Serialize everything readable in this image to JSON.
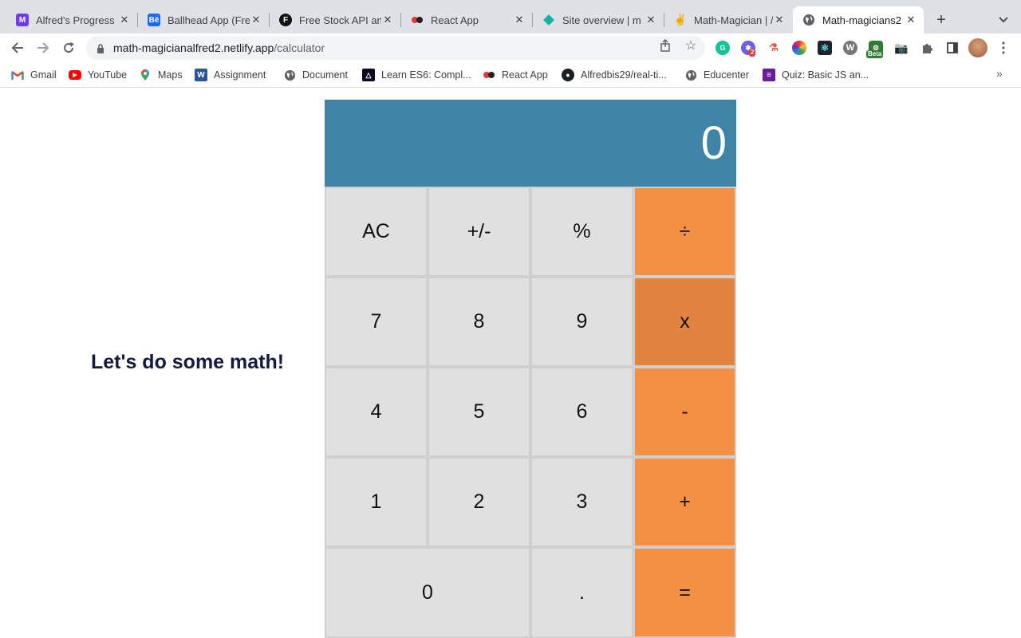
{
  "browser": {
    "tabs": [
      {
        "title": "Alfred's Progress",
        "icon": "microverse-icon",
        "color": "#6f3ae8"
      },
      {
        "title": "Ballhead App (Fre",
        "icon": "behance-icon",
        "color": "#1769ff"
      },
      {
        "title": "Free Stock API an",
        "icon": "finnhub-icon",
        "color": "#111111"
      },
      {
        "title": "React App",
        "icon": "react-app-icon",
        "color": "#e53935"
      },
      {
        "title": "Site overview | m",
        "icon": "netlify-icon",
        "color": "#15b5a6"
      },
      {
        "title": "Math-Magician | /",
        "icon": "vercel-icon",
        "color": "#555555"
      },
      {
        "title": "Math-magicians2",
        "icon": "globe-icon",
        "color": "#5f6368"
      }
    ],
    "active_tab": 6,
    "url_host": "math-magicianalfred2.netlify.app",
    "url_path": "/calculator",
    "bookmarks": [
      {
        "label": "Gmail",
        "icon": "gmail-icon"
      },
      {
        "label": "YouTube",
        "icon": "youtube-icon"
      },
      {
        "label": "Maps",
        "icon": "maps-icon"
      },
      {
        "label": "Assignment",
        "icon": "word-icon"
      },
      {
        "label": "Document",
        "icon": "globe-icon"
      },
      {
        "label": "Learn ES6: Compl...",
        "icon": "es6-icon"
      },
      {
        "label": "React App",
        "icon": "react-app-icon"
      },
      {
        "label": "Alfredbis29/real-ti...",
        "icon": "github-icon"
      },
      {
        "label": "Educenter",
        "icon": "globe-icon"
      },
      {
        "label": "Quiz: Basic JS an...",
        "icon": "quiz-icon"
      }
    ],
    "extension_badge": "2",
    "beta_label": "Beta"
  },
  "page": {
    "heading": "Let's do some math!",
    "display": "0",
    "keys": [
      [
        "AC",
        "+/-",
        "%",
        "÷"
      ],
      [
        "7",
        "8",
        "9",
        "x"
      ],
      [
        "4",
        "5",
        "6",
        "-"
      ],
      [
        "1",
        "2",
        "3",
        "+"
      ],
      [
        "0",
        ".",
        "="
      ]
    ]
  },
  "colors": {
    "display_bg": "#3e84a6",
    "key_bg": "#e0e0e0",
    "operator_bg": "#f39044",
    "heading": "#131a3d"
  }
}
